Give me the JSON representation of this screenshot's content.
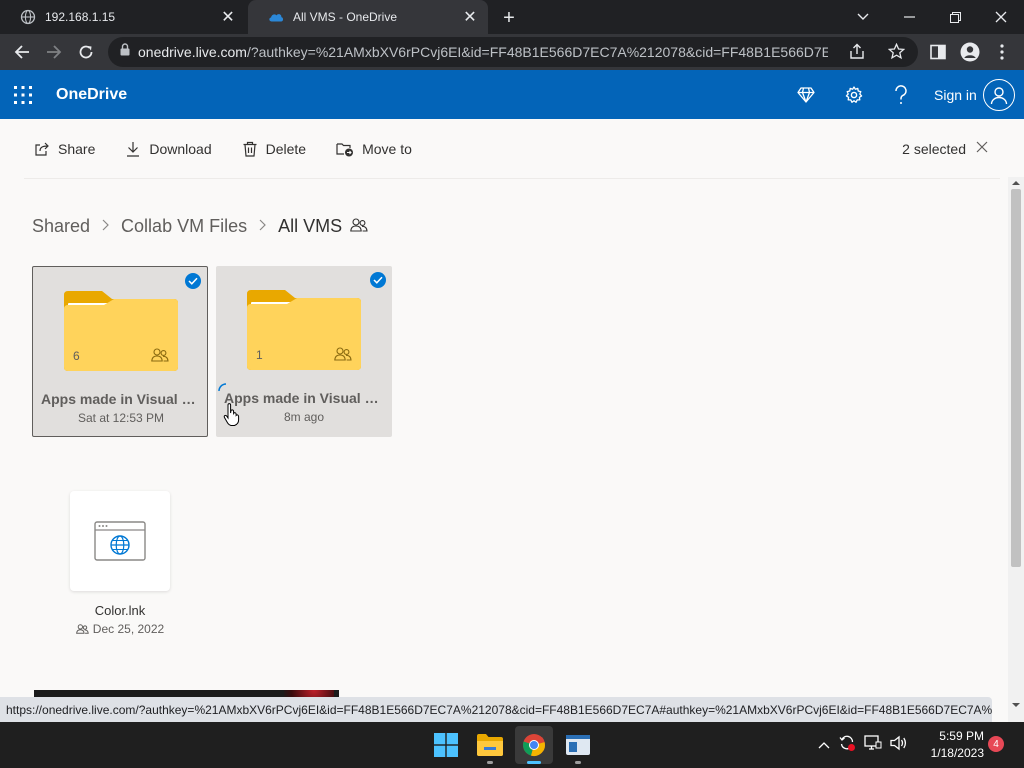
{
  "browser": {
    "tabs": [
      {
        "title": "192.168.1.15",
        "icon": "globe-icon"
      },
      {
        "title": "All VMS - OneDrive",
        "icon": "onedrive-cloud-icon",
        "active": true
      }
    ],
    "url_host": "onedrive.live.com",
    "url_rest": "/?authkey=%21AMxbXV6rPCvj6EI&id=FF48B1E566D7EC7A%212078&cid=FF48B1E566D7EC7A",
    "status_url": "https://onedrive.live.com/?authkey=%21AMxbXV6rPCvj6EI&id=FF48B1E566D7EC7A%212078&cid=FF48B1E566D7EC7A#authkey=%21AMxbXV6rPCvj6EI&id=FF48B1E566D7EC7A%212..."
  },
  "header": {
    "brand": "OneDrive",
    "signin_label": "Sign in",
    "accent": "#0364b8"
  },
  "commands": {
    "share": "Share",
    "download": "Download",
    "delete": "Delete",
    "move_to": "Move to",
    "selected": "2 selected"
  },
  "breadcrumb": {
    "items": [
      "Shared",
      "Collab VM Files",
      "All VMS"
    ]
  },
  "folders": [
    {
      "name": "Apps made in Visual C...",
      "meta": "Sat at 12:53 PM",
      "count": "6",
      "selected": true
    },
    {
      "name": "Apps made in Visual St...",
      "meta": "8m ago",
      "count": "1",
      "selected": true
    }
  ],
  "files": [
    {
      "name": "Color.lnk",
      "meta": "Dec 25, 2022"
    }
  ],
  "taskbar": {
    "time": "5:59 PM",
    "date": "1/18/2023",
    "notifications": "4"
  }
}
